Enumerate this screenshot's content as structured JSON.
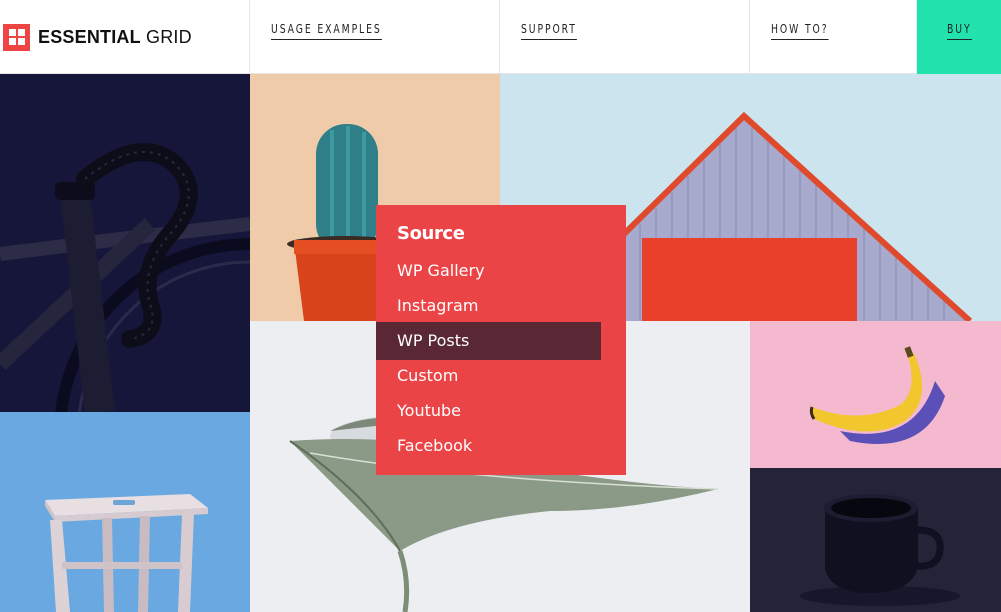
{
  "header": {
    "logo": {
      "bold": "ESSENTIAL",
      "light": "GRID",
      "icon": "grid-logo-icon"
    },
    "nav": [
      {
        "label": "USAGE EXAMPLES"
      },
      {
        "label": "SUPPORT"
      },
      {
        "label": "HOW TO?"
      },
      {
        "label": "BUY"
      }
    ]
  },
  "colors": {
    "accent_red": "#eb4447",
    "buy_green": "#22e3ae",
    "active_item": "#5a2834"
  },
  "dropdown": {
    "title": "Source",
    "items": [
      {
        "label": "WP Gallery",
        "active": false
      },
      {
        "label": "Instagram",
        "active": false
      },
      {
        "label": "WP Posts",
        "active": true
      },
      {
        "label": "Custom",
        "active": false
      },
      {
        "label": "Youtube",
        "active": false
      },
      {
        "label": "Facebook",
        "active": false
      }
    ]
  },
  "tiles": [
    {
      "image": "bicycle-handlebar-photo"
    },
    {
      "image": "cactus-pot-photo"
    },
    {
      "image": "red-barn-photo"
    },
    {
      "image": "wooden-stool-photo"
    },
    {
      "image": "leaf-photo"
    },
    {
      "image": "banana-photo"
    },
    {
      "image": "coffee-cup-photo"
    }
  ]
}
